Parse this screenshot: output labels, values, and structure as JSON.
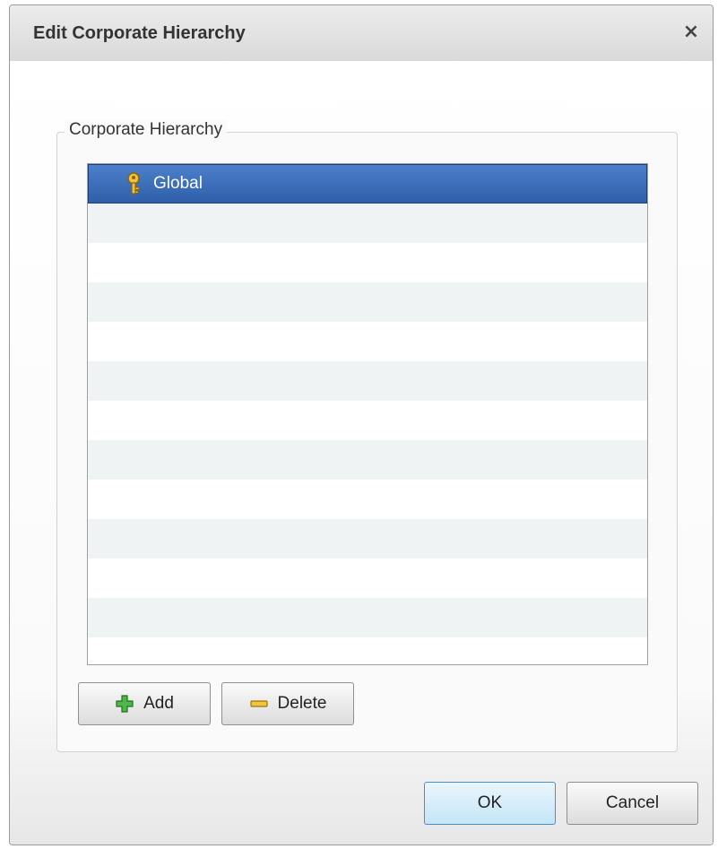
{
  "window": {
    "title": "Edit Corporate Hierarchy",
    "close_glyph": "×"
  },
  "group": {
    "label": "Corporate Hierarchy"
  },
  "hierarchy_list": {
    "items": [
      {
        "label": "Global",
        "icon": "key-icon",
        "selected": true
      }
    ],
    "empty_rows": 11
  },
  "buttons": {
    "add": {
      "label": "Add",
      "icon": "plus-icon"
    },
    "delete": {
      "label": "Delete",
      "icon": "minus-icon"
    },
    "ok": {
      "label": "OK"
    },
    "cancel": {
      "label": "Cancel"
    }
  },
  "colors": {
    "selection": "#3a6dbd",
    "add_icon": "#3fa83a",
    "delete_icon": "#e0b429",
    "key_icon": "#e8b020"
  }
}
